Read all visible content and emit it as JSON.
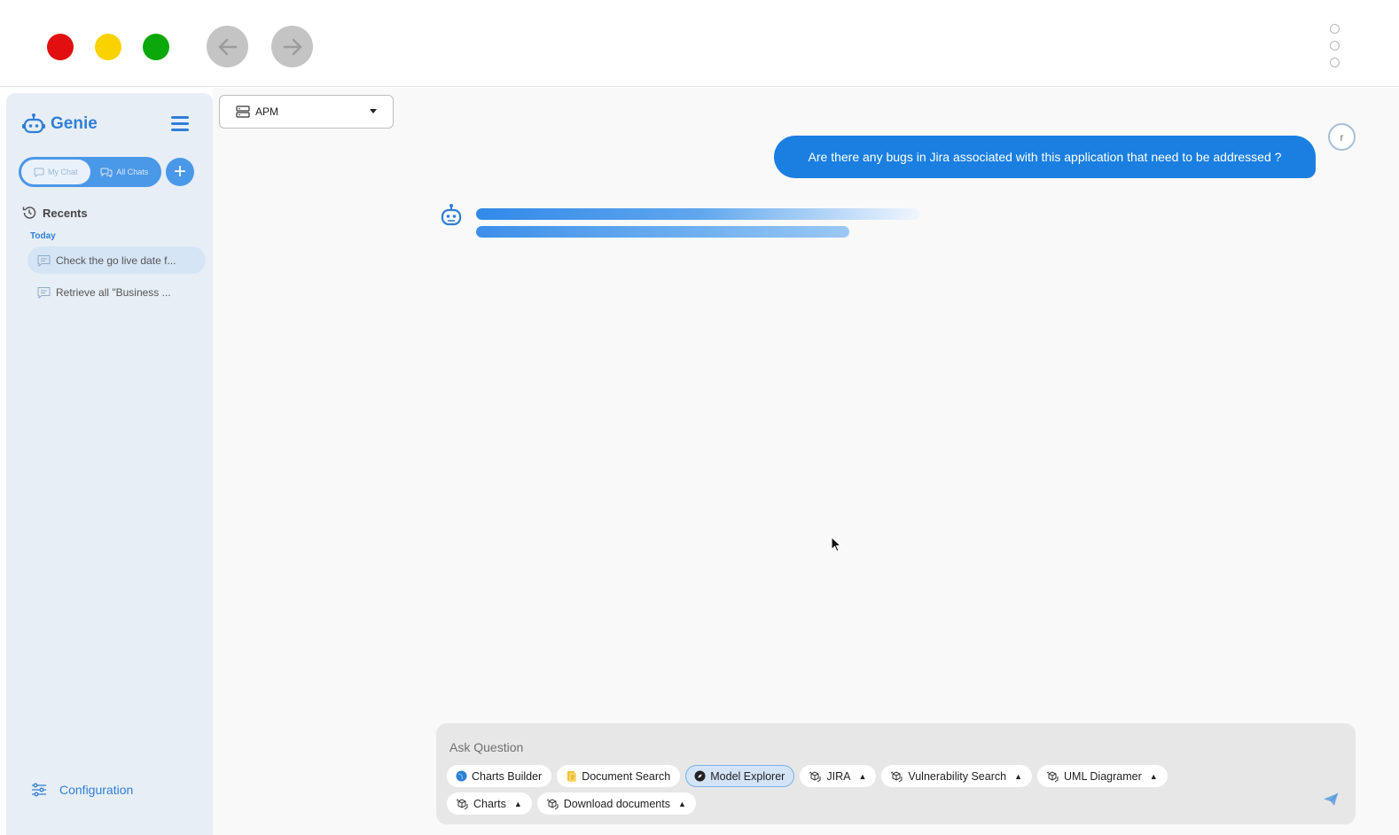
{
  "window": {
    "controls": [
      "close",
      "minimize",
      "maximize"
    ],
    "nav": {
      "back_icon": "arrow-left-icon",
      "forward_icon": "arrow-right-icon"
    }
  },
  "sidebar": {
    "brand": "Genie",
    "toggle": {
      "my_chat": "My Chat",
      "all_chats": "All Chats",
      "active": "my_chat"
    },
    "new_chat_label": "+",
    "recents_title": "Recents",
    "today_label": "Today",
    "recents": [
      {
        "label": "Check the go live date f...",
        "active": true
      },
      {
        "label": "Retrieve all \"Business ...",
        "active": false
      }
    ],
    "configuration_label": "Configuration"
  },
  "header": {
    "app_selector": "APM"
  },
  "chat": {
    "user_avatar_letter": "r",
    "user_message": "Are there any bugs in Jira associated with this application that need to be addressed ?",
    "bot_state": "loading"
  },
  "composer": {
    "placeholder": "Ask Question",
    "chips": [
      {
        "label": "Charts Builder",
        "icon": "globe-icon",
        "selected": false,
        "dropdown": false
      },
      {
        "label": "Document Search",
        "icon": "document-icon",
        "selected": false,
        "dropdown": false
      },
      {
        "label": "Model Explorer",
        "icon": "compass-icon",
        "selected": true,
        "dropdown": false
      },
      {
        "label": "JIRA",
        "icon": "cube-stack-icon",
        "selected": false,
        "dropdown": true
      },
      {
        "label": "Vulnerability Search",
        "icon": "cube-stack-icon",
        "selected": false,
        "dropdown": true
      },
      {
        "label": "UML Diagramer",
        "icon": "cube-stack-icon",
        "selected": false,
        "dropdown": true
      },
      {
        "label": "Charts",
        "icon": "cube-stack-icon",
        "selected": false,
        "dropdown": true
      },
      {
        "label": "Download documents",
        "icon": "cube-stack-icon",
        "selected": false,
        "dropdown": true
      }
    ],
    "dropdown_marker": "▲"
  },
  "colors": {
    "accent": "#1a7fe0",
    "sidebar_bg": "#e8eef6",
    "close": "#e10f0f",
    "minimize": "#f9d200",
    "maximize": "#0aa80a"
  }
}
